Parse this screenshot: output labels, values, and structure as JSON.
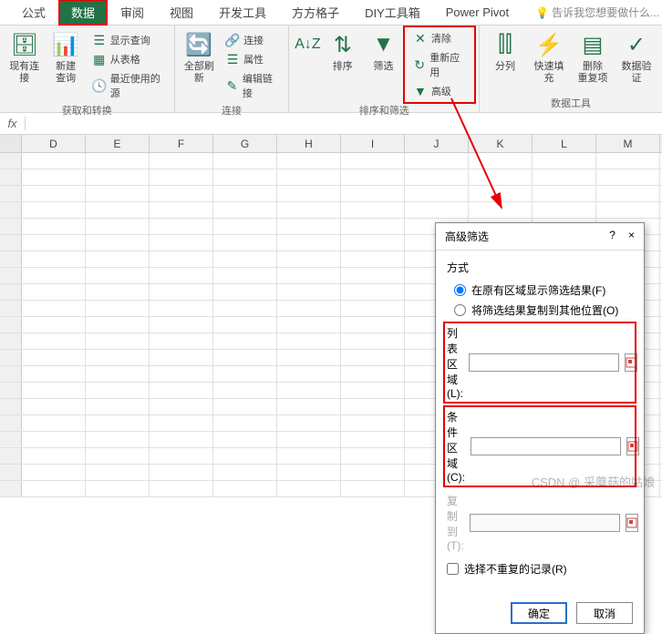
{
  "tabs": {
    "items": [
      "公式",
      "数据",
      "审阅",
      "视图",
      "开发工具",
      "方方格子",
      "DIY工具箱",
      "Power Pivot"
    ],
    "active_index": 1,
    "tell_me": "告诉我您想要做什么..."
  },
  "ribbon": {
    "group1": {
      "label": "获取和转换",
      "btn_conn": "现有连接",
      "btn_newq": "新建\n查询",
      "item_showq": "显示查询",
      "item_fromtable": "从表格",
      "item_recent": "最近使用的源"
    },
    "group2": {
      "label": "连接",
      "btn_refresh": "全部刷新",
      "item_conn": "连接",
      "item_prop": "属性",
      "item_editlink": "编辑链接"
    },
    "group3": {
      "label": "排序和筛选",
      "btn_sort": "排序",
      "btn_filter": "筛选",
      "item_clear": "清除",
      "item_reapply": "重新应用",
      "item_advanced": "高级"
    },
    "group4": {
      "label": "数据工具",
      "btn_split": "分列",
      "btn_flash": "快速填充",
      "btn_dedup": "删除\n重复项",
      "btn_valid": "数据验\n证"
    }
  },
  "columns": [
    "D",
    "E",
    "F",
    "G",
    "H",
    "I",
    "J",
    "K",
    "L",
    "M"
  ],
  "dialog": {
    "title": "高级筛选",
    "help": "?",
    "close": "×",
    "method_label": "方式",
    "radio1": "在原有区域显示筛选结果(F)",
    "radio2": "将筛选结果复制到其他位置(O)",
    "list_range": "列表区域(L):",
    "criteria_range": "条件区域(C):",
    "copy_to": "复制到(T):",
    "unique": "选择不重复的记录(R)",
    "ok": "确定",
    "cancel": "取消",
    "list_val": "",
    "crit_val": "",
    "copy_val": ""
  },
  "watermark": "CSDN @ 采蘑菇的姑娘"
}
